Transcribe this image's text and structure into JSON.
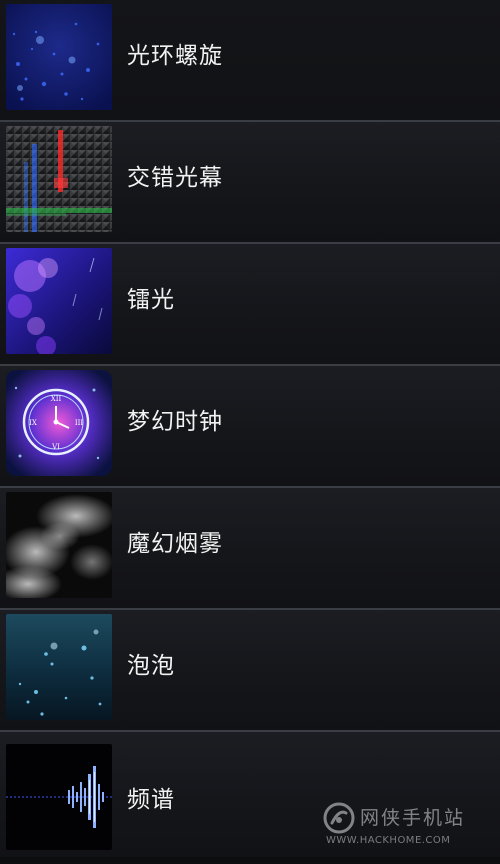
{
  "wallpapers": [
    {
      "label": "光环螺旋",
      "thumbnail_icon": "blue-particle-thumbnail"
    },
    {
      "label": "交错光幕",
      "thumbnail_icon": "light-grid-thumbnail"
    },
    {
      "label": "镭光",
      "thumbnail_icon": "purple-bokeh-thumbnail"
    },
    {
      "label": "梦幻时钟",
      "thumbnail_icon": "dream-clock-thumbnail"
    },
    {
      "label": "魔幻烟雾",
      "thumbnail_icon": "smoke-thumbnail"
    },
    {
      "label": "泡泡",
      "thumbnail_icon": "bubbles-thumbnail"
    },
    {
      "label": "频谱",
      "thumbnail_icon": "spectrum-thumbnail"
    }
  ],
  "watermark": {
    "name": "网侠手机站",
    "url": "WWW.HACKHOME.COM"
  },
  "colors": {
    "background": "#0c0d0f",
    "divider": "#3a3d44",
    "label": "#f2f2f2"
  }
}
